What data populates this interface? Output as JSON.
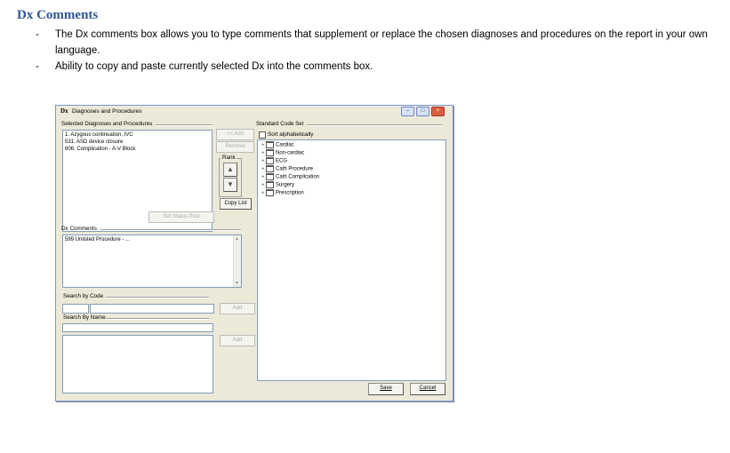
{
  "doc": {
    "heading": "Dx Comments",
    "bullets": [
      "The Dx comments box allows you to type comments that supplement or replace the chosen diagnoses and procedures on the report in your own language.",
      "Ability to copy and paste currently selected Dx into the comments box."
    ],
    "dash": "-"
  },
  "dialog": {
    "title_icon": "Dx",
    "title": "Diagnoses and Procedures",
    "selected_label": "Selected Diagnoses and Procedures",
    "selected_items": [
      "1. Azygous continuation, IVC",
      "531. ASD device closure",
      "606. Complication - A-V Block"
    ],
    "add_button": "<< Add",
    "remove_button": "Remove",
    "rank_label": "Rank",
    "up_arrow": "▲",
    "down_arrow": "▼",
    "copy_list_button": "Copy List",
    "set_status_post_button": "Set Status Post",
    "dx_comments_label": "Dx Comments",
    "dx_comments_value": "599 Unlisted Procedure - ...",
    "search_by_code_label": "Search by Code",
    "search_code_add": "Add",
    "search_by_name_label": "Search By Name",
    "search_name_add": "Add",
    "standard_code_set_label": "Standard Code Set",
    "sort_alpha_label": "Sort alphabetically",
    "tree_items": [
      "Cardiac",
      "Non-cardiac",
      "ECG",
      "Cath Procedure",
      "Cath Complication",
      "Surgery",
      "Prescription"
    ],
    "save_button": "Save",
    "cancel_button": "Cancel",
    "minimize": "–",
    "maximize": "□",
    "close": "×"
  },
  "colors": {
    "heading": "#2f5597",
    "window_bg": "#ece9d8",
    "close_btn": "#d9603e"
  }
}
